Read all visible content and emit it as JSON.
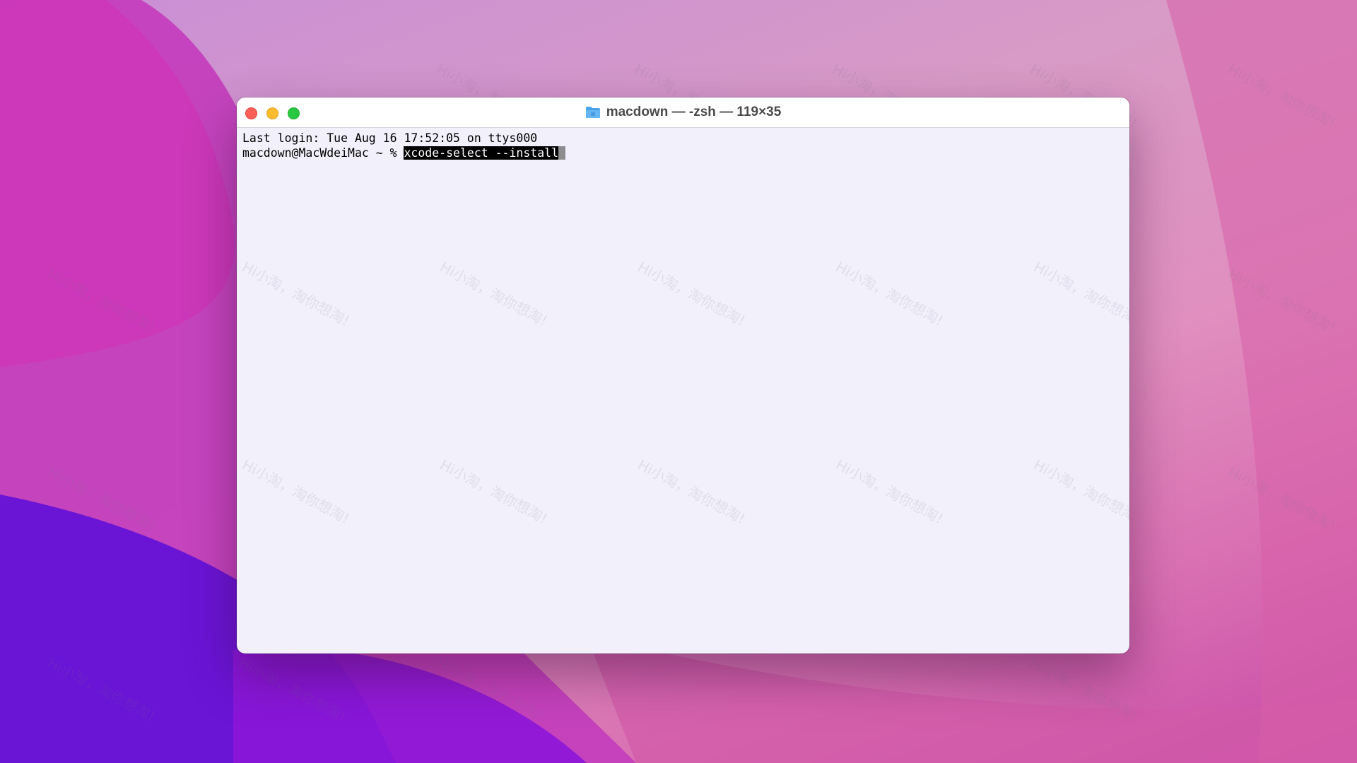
{
  "window": {
    "title": "macdown — -zsh — 119×35",
    "title_icon": "folder-icon",
    "traffic_lights": {
      "close": "#fe5f57",
      "minimize": "#febc2e",
      "maximize": "#28c840"
    }
  },
  "terminal": {
    "last_login": "Last login: Tue Aug 16 17:52:05 on ttys000",
    "prompt": "macdown@MacWdeiMac ~ % ",
    "command": "xcode-select --install"
  },
  "watermark": {
    "text": "Hi小淘，淘你想淘!"
  },
  "colors": {
    "terminal_background": "#f2f0fb",
    "selection": "#000000",
    "cursor": "#8d8d8f"
  }
}
